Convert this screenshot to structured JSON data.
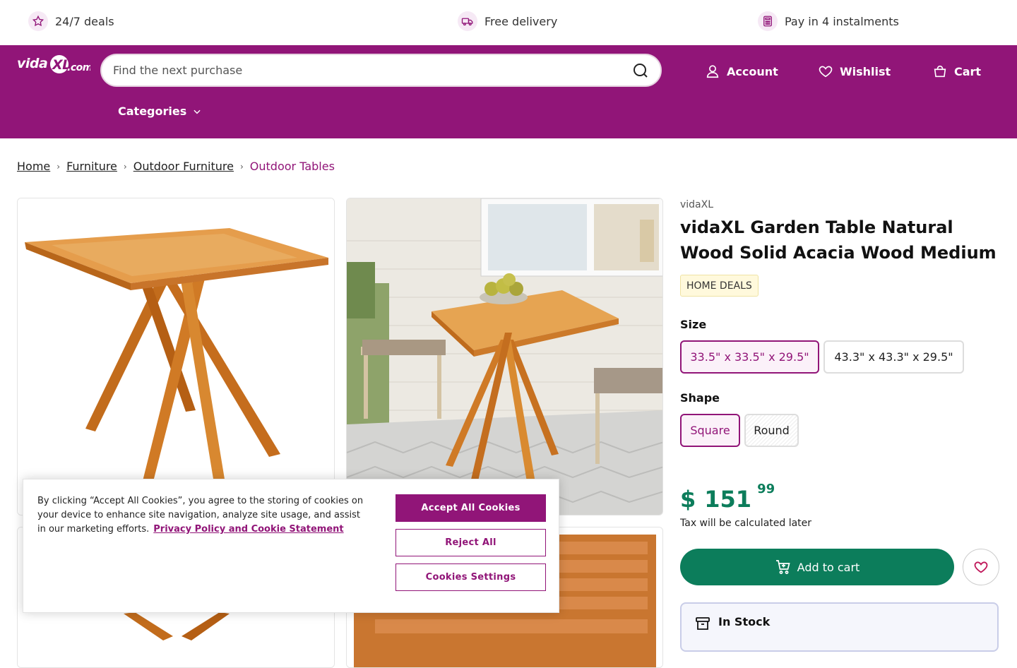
{
  "usp": [
    {
      "label": "24/7 deals",
      "icon": "star-icon"
    },
    {
      "label": "Free delivery",
      "icon": "truck-icon"
    },
    {
      "label": "Pay in 4 instalments",
      "icon": "calculator-icon"
    }
  ],
  "header": {
    "logo": "vidaXL.com",
    "search_placeholder": "Find the next purchase",
    "account": "Account",
    "wishlist": "Wishlist",
    "cart": "Cart",
    "categories": "Categories",
    "brand_color": "#911578"
  },
  "breadcrumb": {
    "items": [
      "Home",
      "Furniture",
      "Outdoor Furniture"
    ],
    "current": "Outdoor Tables"
  },
  "product": {
    "brand": "vidaXL",
    "title": "vidaXL Garden Table Natural Wood Solid Acacia Wood Medium",
    "badge": "HOME DEALS",
    "size_label": "Size",
    "sizes": [
      "33.5\" x 33.5\" x 29.5\"",
      "43.3\" x 43.3\" x 29.5\""
    ],
    "selected_size": "33.5\" x 33.5\" x 29.5\"",
    "shape_label": "Shape",
    "shapes": [
      "Square",
      "Round"
    ],
    "selected_shape": "Square",
    "price_currency": "$",
    "price_int": "151",
    "price_dec": "99",
    "tax_note": "Tax will be calculated later",
    "add_to_cart": "Add to cart",
    "stock": "In Stock",
    "price_color": "#0c7d5b"
  },
  "cookie": {
    "text": "By clicking “Accept All Cookies”, you agree to the storing of cookies on your device to enhance site navigation, analyze site usage, and assist in our marketing efforts.",
    "link": "Privacy Policy and Cookie Statement",
    "accept": "Accept All Cookies",
    "reject": "Reject All",
    "settings": "Cookies Settings"
  }
}
